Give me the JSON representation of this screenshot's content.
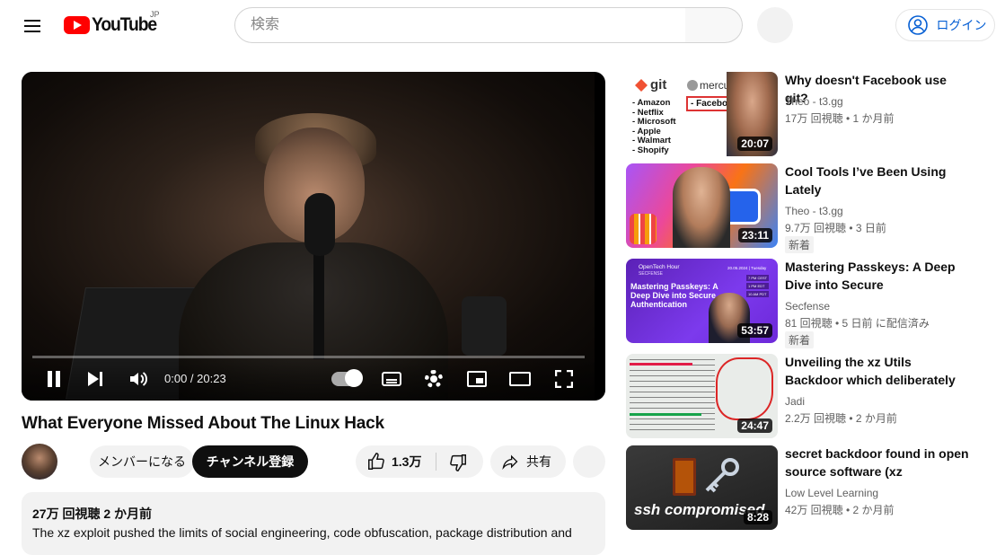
{
  "header": {
    "logo_text": "YouTube",
    "region": "JP",
    "search_placeholder": "検索",
    "login_label": "ログイン"
  },
  "player": {
    "time": "0:00 / 20:23",
    "progress": 0.0
  },
  "video": {
    "title": "What Everyone Missed About The Linux Hack",
    "member_label": "メンバーになる",
    "subscribe_label": "チャンネル登録",
    "like_count": "1.3万",
    "share_label": "共有",
    "views_date": "27万 回視聴  2 か月前",
    "description": "The xz exploit pushed the limits of social engineering, code obfuscation, package distribution and"
  },
  "recommendations": [
    {
      "title": "Why doesn't Facebook use git?",
      "channel": "Theo - t3.gg",
      "stats": "17万 回視聴 • 1 か月前",
      "badge": "",
      "duration": "20:07",
      "thumb": {
        "git_label": "git",
        "hg_label": "mercurial",
        "fb_label": "- Facebook",
        "companies": [
          "- Amazon",
          "- Netflix",
          "- Microsoft",
          "- Apple",
          "- Walmart",
          "- Shopify"
        ]
      }
    },
    {
      "title": "Cool Tools I’ve Been Using Lately",
      "channel": "Theo - t3.gg",
      "stats": "9.7万 回視聴 • 3 日前",
      "badge": "新着",
      "duration": "23:11"
    },
    {
      "title": "Mastering Passkeys: A Deep Dive into Secure Authentication",
      "channel": "Secfense",
      "stats": "81 回視聴 • 5 日前 に配信済み",
      "badge": "新着",
      "duration": "53:57",
      "thumb": {
        "brand": "OpenTech Hour",
        "org": "SECFENSE",
        "date": "20.05.2024 | Tuesday",
        "heading": "Mastering Passkeys: A Deep Dive into Secure Authentication",
        "times": [
          "7 PM CEST",
          "1 PM EDT",
          "10 AM PDT"
        ]
      }
    },
    {
      "title": "Unveiling the xz Utils Backdoor which deliberately opens our…",
      "channel": "Jadi",
      "stats": "2.2万 回視聴 • 2 か月前",
      "badge": "",
      "duration": "24:47"
    },
    {
      "title": "secret backdoor found in open source software (xz situation…",
      "channel": "Low Level Learning",
      "stats": "42万 回視聴 • 2 か月前",
      "badge": "",
      "duration": "8:28",
      "thumb": {
        "caption": "ssh compromised"
      }
    }
  ]
}
